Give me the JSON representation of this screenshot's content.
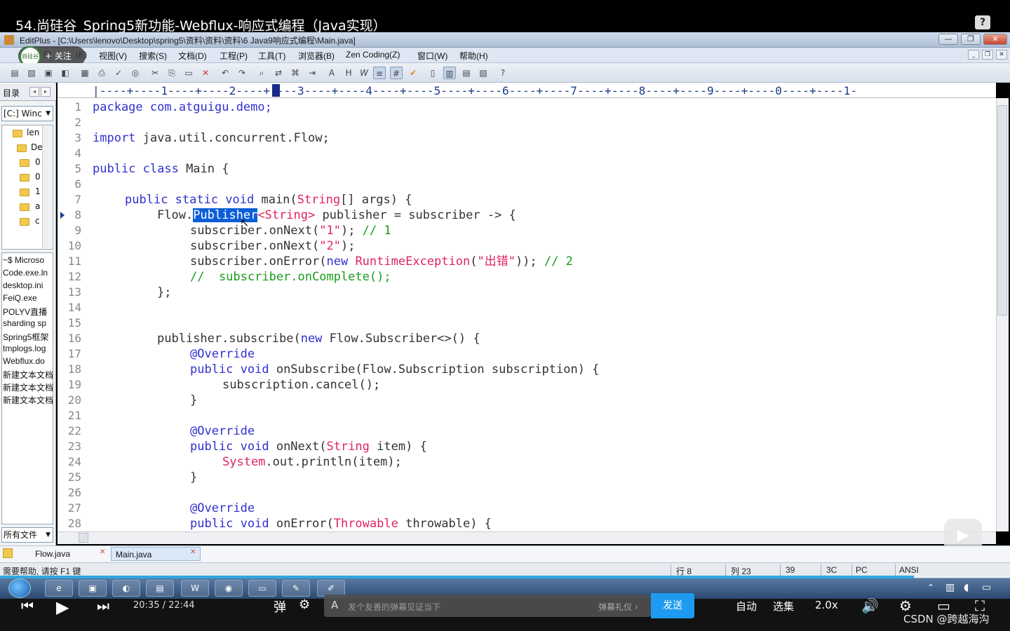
{
  "video": {
    "title": "54.尚硅谷_Spring5新功能-Webflux-响应式编程（Java实现）",
    "help_icon": "?"
  },
  "window": {
    "title": "EditPlus - [C:\\Users\\lenovo\\Desktop\\spring5\\资料\\资料\\资料\\6 Java9响应式编程\\Main.java]",
    "min": "—",
    "max": "❐",
    "close": "✕"
  },
  "follow": {
    "avatar": "尚硅谷",
    "label": "+ 关注"
  },
  "menu": {
    "items": [
      "F)",
      "(E)",
      "视图(V)",
      "搜索(S)",
      "文档(D)",
      "工程(P)",
      "工具(T)",
      "浏览器(B)",
      "Zen Coding(Z)",
      "窗口(W)",
      "帮助(H)"
    ]
  },
  "left_panel": {
    "tab": "目录",
    "drive": "[C:] Winc",
    "tree": [
      "len",
      "De",
      "0",
      "0",
      "1",
      "a",
      "c"
    ],
    "files": [
      "~$ Microso",
      "Code.exe.ln",
      "desktop.ini",
      "FeiQ.exe",
      "POLYV直播",
      "sharding sp",
      "Spring5框架",
      "tmplogs.log",
      "Webflux.do",
      "新建文本文档",
      "新建文本文档",
      "新建文本文档"
    ],
    "filter": "所有文件"
  },
  "ruler": {
    "text": "|----+----1----+----2----+----3----+----4----+----5----+----6----+----7----+----8----+----9----+----0----+----1-"
  },
  "editor": {
    "lines": [
      {
        "n": "1"
      },
      {
        "n": "2"
      },
      {
        "n": "3"
      },
      {
        "n": "4"
      },
      {
        "n": "5"
      },
      {
        "n": "6"
      },
      {
        "n": "7"
      },
      {
        "n": "8"
      },
      {
        "n": "9"
      },
      {
        "n": "10"
      },
      {
        "n": "11"
      },
      {
        "n": "12"
      },
      {
        "n": "13"
      },
      {
        "n": "14"
      },
      {
        "n": "15"
      },
      {
        "n": "16"
      },
      {
        "n": "17"
      },
      {
        "n": "18"
      },
      {
        "n": "19"
      },
      {
        "n": "20"
      },
      {
        "n": "21"
      },
      {
        "n": "22"
      },
      {
        "n": "23"
      },
      {
        "n": "24"
      },
      {
        "n": "25"
      },
      {
        "n": "26"
      },
      {
        "n": "27"
      },
      {
        "n": "28"
      }
    ],
    "code": {
      "l1": "package com.atguigu.demo;",
      "l3a": "import",
      "l3b": " java.util.concurrent.Flow;",
      "l5a": "public class",
      "l5b": " Main {",
      "l7a": "public static void",
      "l7b": " main(",
      "l7c": "String",
      "l7d": "[] args) {",
      "l8a": "Flow.",
      "l8b": "Publisher",
      "l8c": "<String>",
      "l8d": " publisher = subscriber -> {",
      "l9a": "subscriber.onNext(",
      "l9b": "\"1\"",
      "l9c": "); ",
      "l9d": "// 1",
      "l10a": "subscriber.onNext(",
      "l10b": "\"2\"",
      "l10c": ");",
      "l11a": "subscriber.onError(",
      "l11b": "new",
      "l11c": " ",
      "l11d": "RuntimeException",
      "l11e": "(",
      "l11f": "\"出错\"",
      "l11g": ")); ",
      "l11h": "// 2",
      "l12": "//  subscriber.onComplete();",
      "l13": "};",
      "l16a": "publisher.subscribe(",
      "l16b": "new",
      "l16c": " Flow.Subscriber<>() {",
      "l17": "@Override",
      "l18a": "public void",
      "l18b": " onSubscribe(Flow.Subscription subscription) {",
      "l19": "subscription.cancel();",
      "l20": "}",
      "l22": "@Override",
      "l23a": "public void",
      "l23b": " onNext(",
      "l23c": "String",
      "l23d": " item) {",
      "l24a": "System",
      "l24b": ".out.println(item);",
      "l25": "}",
      "l27": "@Override",
      "l28a": "public void",
      "l28b": " onError(",
      "l28c": "Throwable",
      "l28d": " throwable) {"
    }
  },
  "tabs": [
    {
      "label": "Flow.java",
      "active": false
    },
    {
      "label": "Main.java",
      "active": true
    }
  ],
  "status": {
    "help": "需要帮助, 请按 F1 键",
    "row": "行 8",
    "col": "列 23",
    "n1": "39",
    "n2": "3C",
    "mode": "PC",
    "enc": "ANSI"
  },
  "player": {
    "time": "20:35  /  22:44",
    "danmu_placeholder": "发个友善的弹幕见证当下",
    "danmu_gift": "弹幕礼仪 ›",
    "send": "发送",
    "auto": "自动",
    "episodes": "选集",
    "speed": "2.0x",
    "progress": 0.905
  },
  "watermark": "CSDN @跨越海沟"
}
